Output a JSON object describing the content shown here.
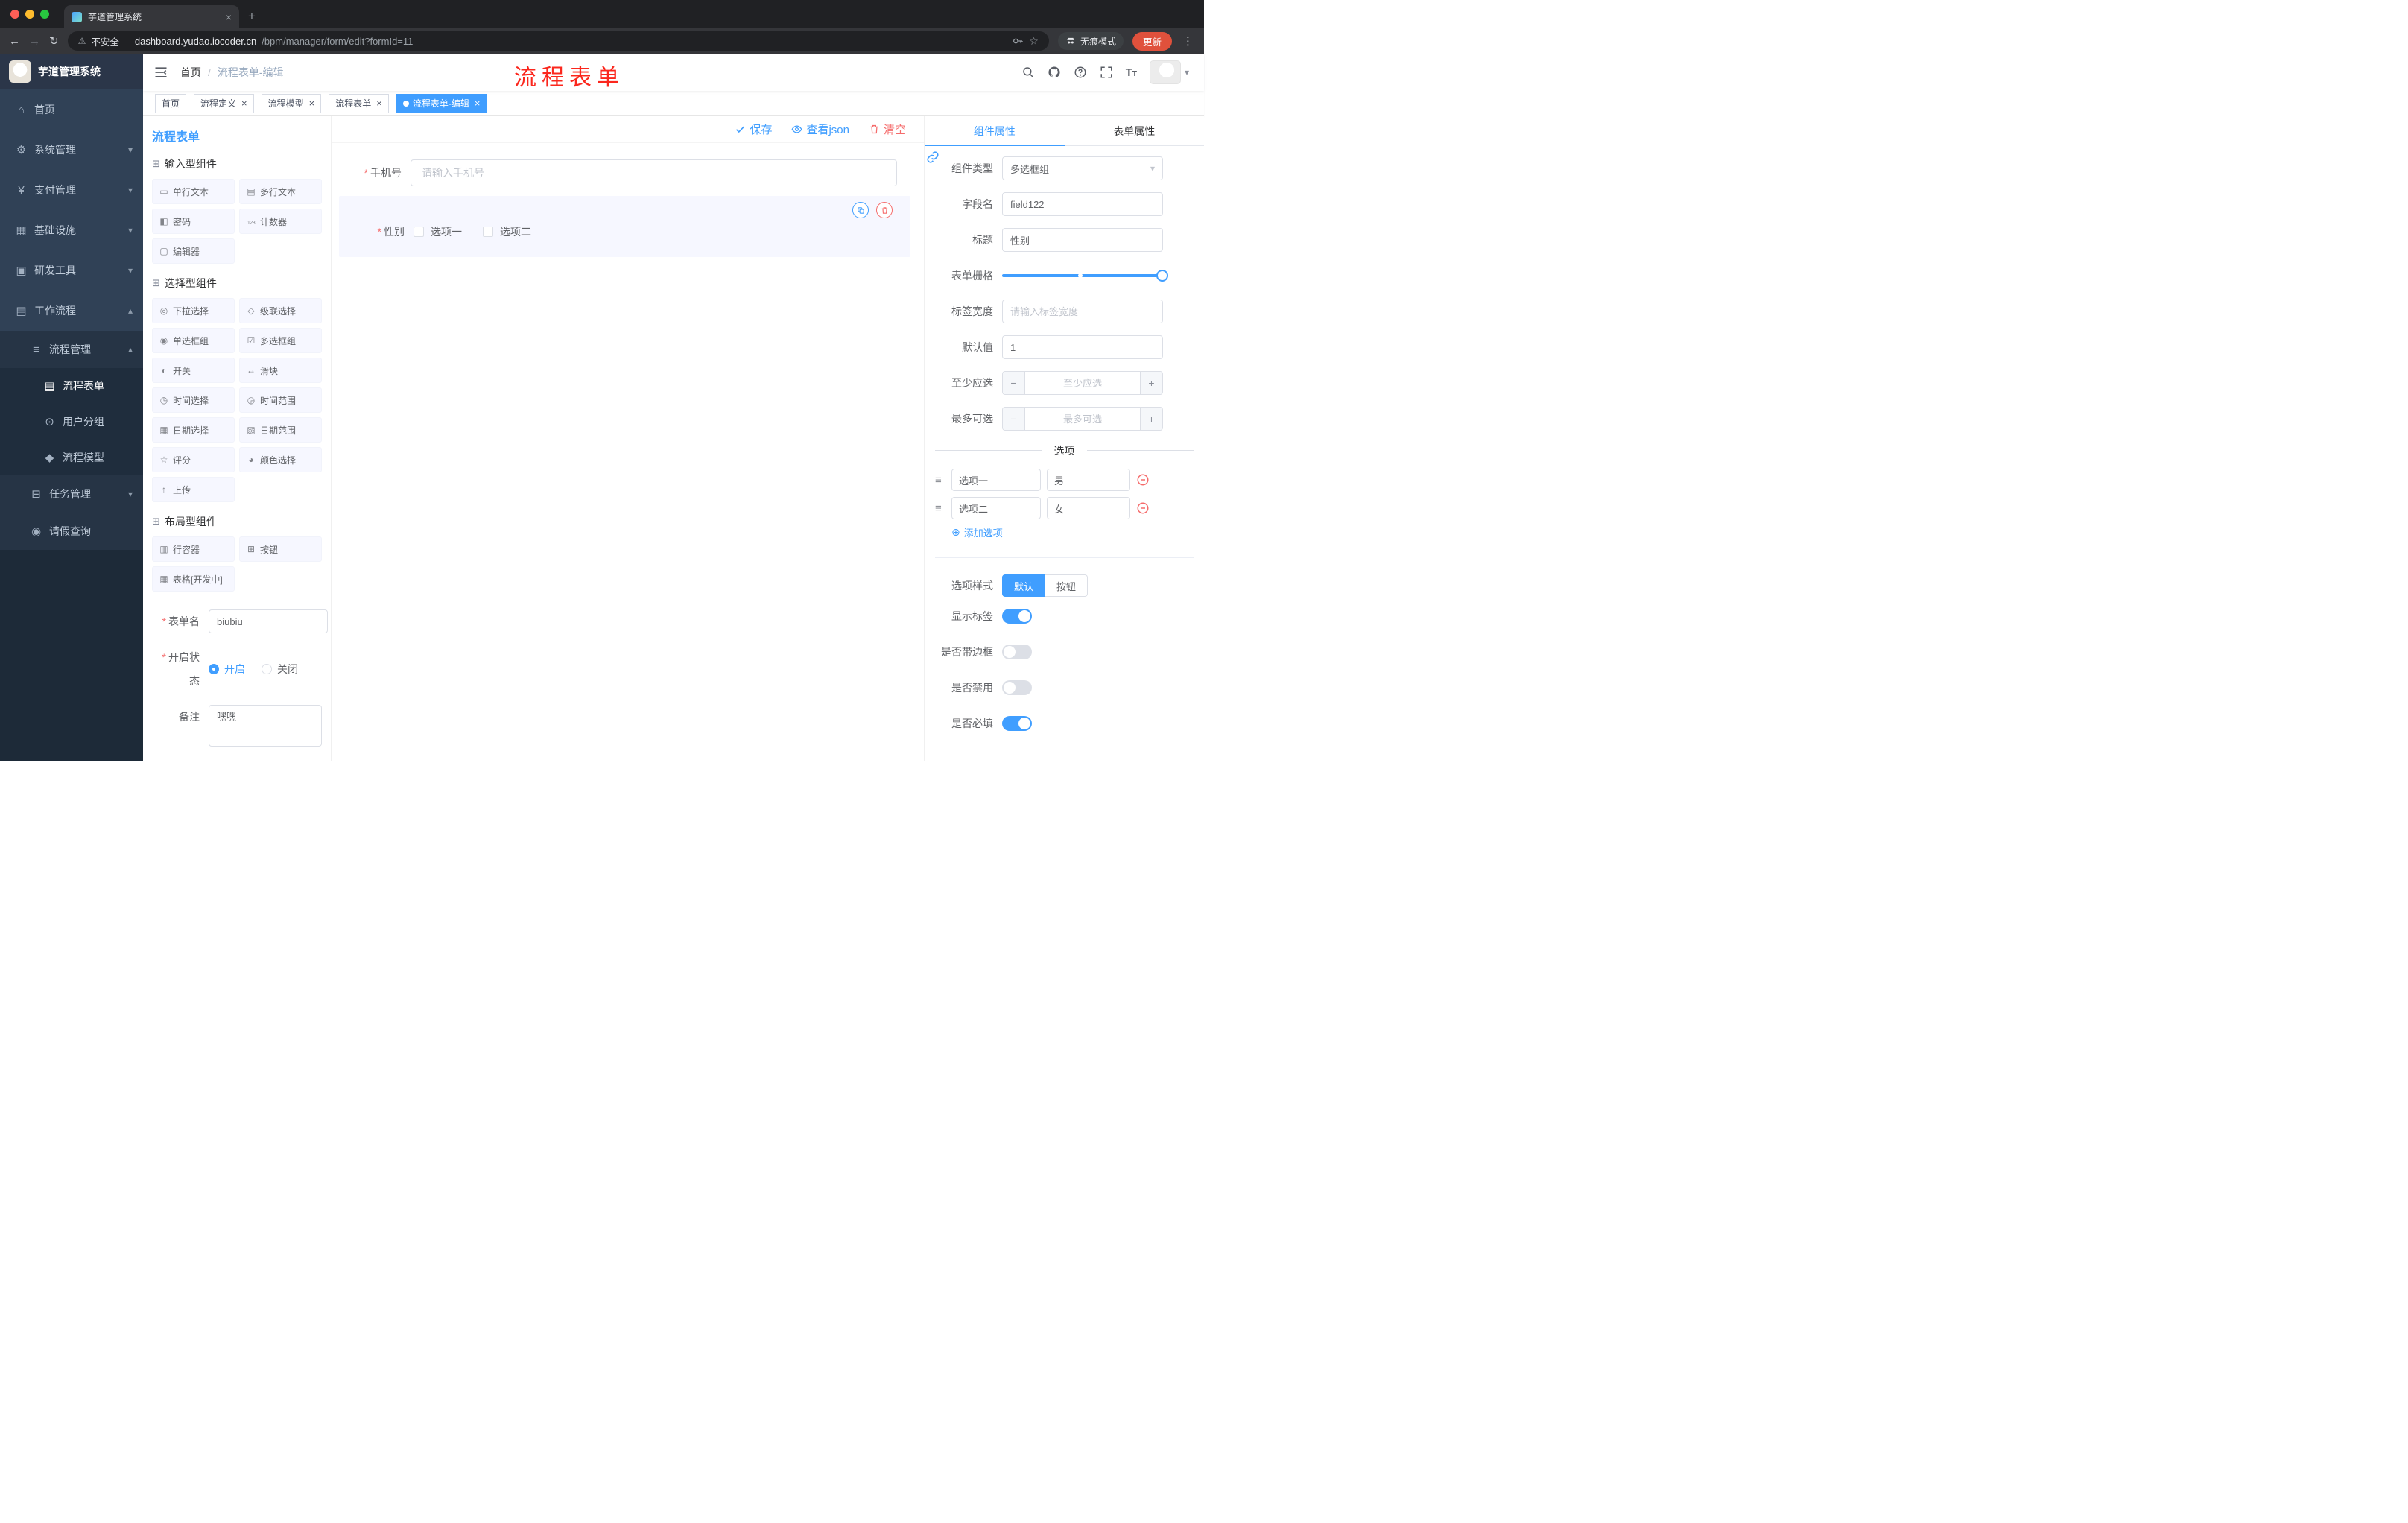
{
  "colors": {
    "accent": "#409EFF",
    "danger": "#F56C6C",
    "annotation_red": "#FB271D",
    "sidebar_bg": "#304156",
    "sidebar_sub_bg": "#1F2D3D",
    "update_button_bg": "#E0513C"
  },
  "browser": {
    "tab_title": "芋道管理系统",
    "security_label": "不安全",
    "url_domain": "dashboard.yudao.iocoder.cn",
    "url_path": "/bpm/manager/form/edit?formId=11",
    "incognito_label": "无痕模式",
    "update_label": "更新"
  },
  "sidebar": {
    "logo_title": "芋道管理系统",
    "menu": [
      {
        "label": "首页",
        "level": 0
      },
      {
        "label": "系统管理",
        "level": 0,
        "expandable": true
      },
      {
        "label": "支付管理",
        "level": 0,
        "expandable": true
      },
      {
        "label": "基础设施",
        "level": 0,
        "expandable": true
      },
      {
        "label": "研发工具",
        "level": 0,
        "expandable": true
      },
      {
        "label": "工作流程",
        "level": 0,
        "expanded": true
      },
      {
        "label": "流程管理",
        "level": 1,
        "expanded": true
      },
      {
        "label": "流程表单",
        "level": 2,
        "active": true
      },
      {
        "label": "用户分组",
        "level": 2
      },
      {
        "label": "流程模型",
        "level": 2
      },
      {
        "label": "任务管理",
        "level": 1,
        "expandable": true
      },
      {
        "label": "请假查询",
        "level": 1
      }
    ]
  },
  "header": {
    "breadcrumb_home": "首页",
    "breadcrumb_separator": "/",
    "breadcrumb_current": "流程表单-编辑",
    "annotation": "流程表单"
  },
  "tags": [
    {
      "label": "首页",
      "closable": false,
      "active": false
    },
    {
      "label": "流程定义",
      "closable": true,
      "active": false
    },
    {
      "label": "流程模型",
      "closable": true,
      "active": false
    },
    {
      "label": "流程表单",
      "closable": true,
      "active": false
    },
    {
      "label": "流程表单-编辑",
      "closable": true,
      "active": true
    }
  ],
  "palette": {
    "title": "流程表单",
    "groups": [
      {
        "title": "输入型组件",
        "items": [
          "单行文本",
          "多行文本",
          "密码",
          "计数器",
          "编辑器"
        ]
      },
      {
        "title": "选择型组件",
        "items": [
          "下拉选择",
          "级联选择",
          "单选框组",
          "多选框组",
          "开关",
          "滑块",
          "时间选择",
          "时间范围",
          "日期选择",
          "日期范围",
          "评分",
          "颜色选择",
          "上传"
        ]
      },
      {
        "title": "布局型组件",
        "items": [
          "行容器",
          "按钮",
          "表格[开发中]"
        ]
      }
    ],
    "form": {
      "name_label": "表单名",
      "name_value": "biubiu",
      "status_label": "开启状态",
      "status_on": "开启",
      "status_off": "关闭",
      "status_selected": "开启",
      "remark_label": "备注",
      "remark_value": "嘿嘿"
    }
  },
  "canvas": {
    "save_label": "保存",
    "view_json_label": "查看json",
    "clear_label": "清空",
    "phone_label": "手机号",
    "phone_placeholder": "请输入手机号",
    "gender_label": "性别",
    "gender_option1": "选项一",
    "gender_option2": "选项二"
  },
  "props": {
    "tab_component": "组件属性",
    "tab_form": "表单属性",
    "component_type_label": "组件类型",
    "component_type_value": "多选框组",
    "field_name_label": "字段名",
    "field_name_value": "field122",
    "title_label": "标题",
    "title_value": "性别",
    "grid_label": "表单栅格",
    "label_width_label": "标签宽度",
    "label_width_placeholder": "请输入标签宽度",
    "default_label": "默认值",
    "default_value": "1",
    "min_label": "至少应选",
    "min_placeholder": "至少应选",
    "max_label": "最多可选",
    "max_placeholder": "最多可选",
    "options_title": "选项",
    "options": [
      {
        "label": "选项一",
        "value": "男"
      },
      {
        "label": "选项二",
        "value": "女"
      }
    ],
    "add_option_label": "添加选项",
    "option_style_label": "选项样式",
    "style_default": "默认",
    "style_button": "按钮",
    "style_selected": "默认",
    "switches": {
      "show_label": {
        "label": "显示标签",
        "on": true
      },
      "border": {
        "label": "是否带边框",
        "on": false
      },
      "disabled": {
        "label": "是否禁用",
        "on": false
      },
      "required": {
        "label": "是否必填",
        "on": true
      }
    }
  }
}
